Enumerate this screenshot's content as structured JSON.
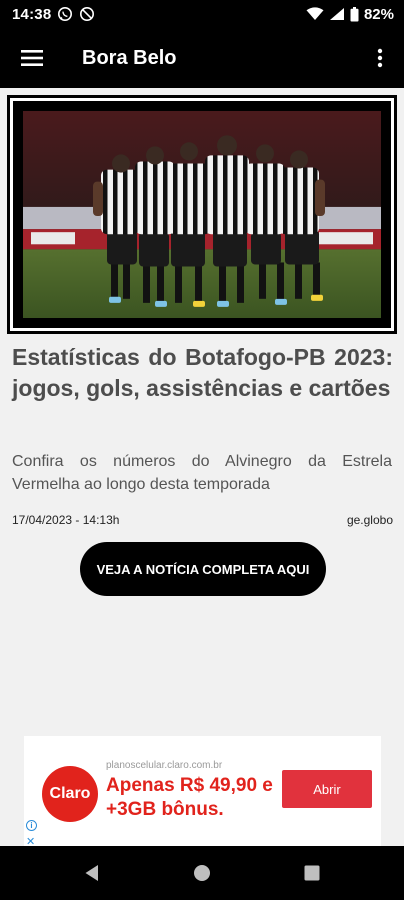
{
  "status_bar": {
    "time": "14:38",
    "battery": "82%"
  },
  "app_bar": {
    "title": "Bora Belo"
  },
  "article": {
    "headline": "Estatísticas do Botafogo-PB 2023: jogos, gols, assistências e cartões",
    "summary": "Confira os números do Alvinegro da Estrela Vermelha ao longo desta temporada",
    "date": "17/04/2023 - 14:13h",
    "source": "ge.globo",
    "cta_label": "VEJA A NOTÍCIA COMPLETA AQUI"
  },
  "ad": {
    "logo_text": "Claro",
    "url": "planoscelular.claro.com.br",
    "headline": "Apenas R$ 49,90 e +3GB bônus.",
    "button_label": "Abrir",
    "close_glyph": "✕",
    "info_glyph": "i"
  },
  "colors": {
    "brand": "#000000",
    "ad_red": "#e1231c"
  },
  "icons": {
    "menu": "menu-icon",
    "more": "more-vert-icon",
    "back": "back-icon",
    "home": "home-icon",
    "recents": "recents-icon"
  }
}
